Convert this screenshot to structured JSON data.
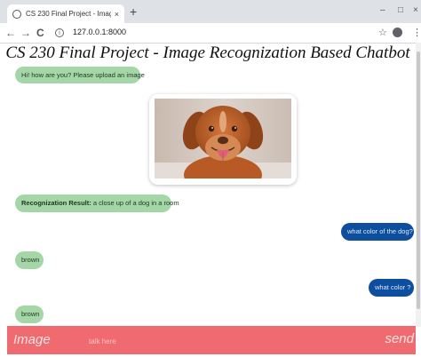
{
  "browser": {
    "tab_title": "CS 230 Final Project - Imag",
    "tab_close": "×",
    "new_tab": "+",
    "minimize": "–",
    "maximize": "□",
    "close": "×",
    "back": "←",
    "forward": "→",
    "reload": "C",
    "url": "127.0.0.1:8000",
    "bookmark": "☆",
    "menu": "⋮"
  },
  "page": {
    "title": "CS 230 Final Project - Image Recognization Based Chatbot"
  },
  "chat": {
    "greeting": "Hi! how are you? Please upload an image",
    "recognition_label": "Recognization Result:",
    "recognition_text": "a close up of a dog in a room",
    "user_msg_1": "what color of the dog?",
    "bot_reply_1": "brown",
    "user_msg_2": "what color ?",
    "bot_reply_2": "brown"
  },
  "input_bar": {
    "image_label": "Image",
    "placeholder": "talk here",
    "send_label": "send"
  },
  "colors": {
    "bot_bubble": "#a5d6a7",
    "user_bubble": "#0d4f9e",
    "input_bar": "#ef6b6f"
  }
}
